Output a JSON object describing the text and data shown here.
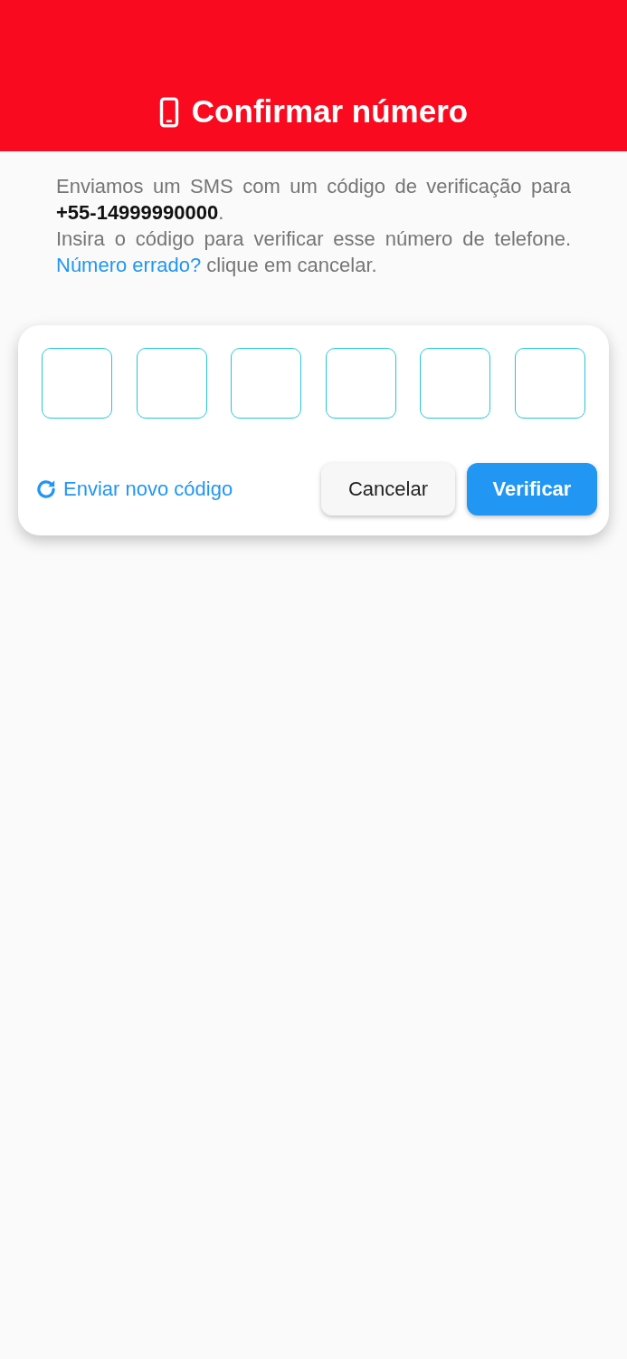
{
  "header": {
    "title": "Confirmar número"
  },
  "message": {
    "intro": "Enviamos um SMS com um código de verificação para **+55-14999990000**.",
    "instruction": "Insira o código para verificar esse número de telefone.",
    "link": "Número errado?",
    "after": "clique em cancelar."
  },
  "code_fields": [
    {
      "focused": false
    },
    {
      "focused": false
    },
    {
      "focused": false
    },
    {
      "focused": false
    },
    {
      "focused": false
    },
    {
      "focused": false
    }
  ],
  "resend_link": "Enviar novo código",
  "buttons": [
    {
      "label": "Cancelar",
      "kind": "secondary"
    },
    {
      "label": "Verificar",
      "kind": "primary"
    }
  ]
}
